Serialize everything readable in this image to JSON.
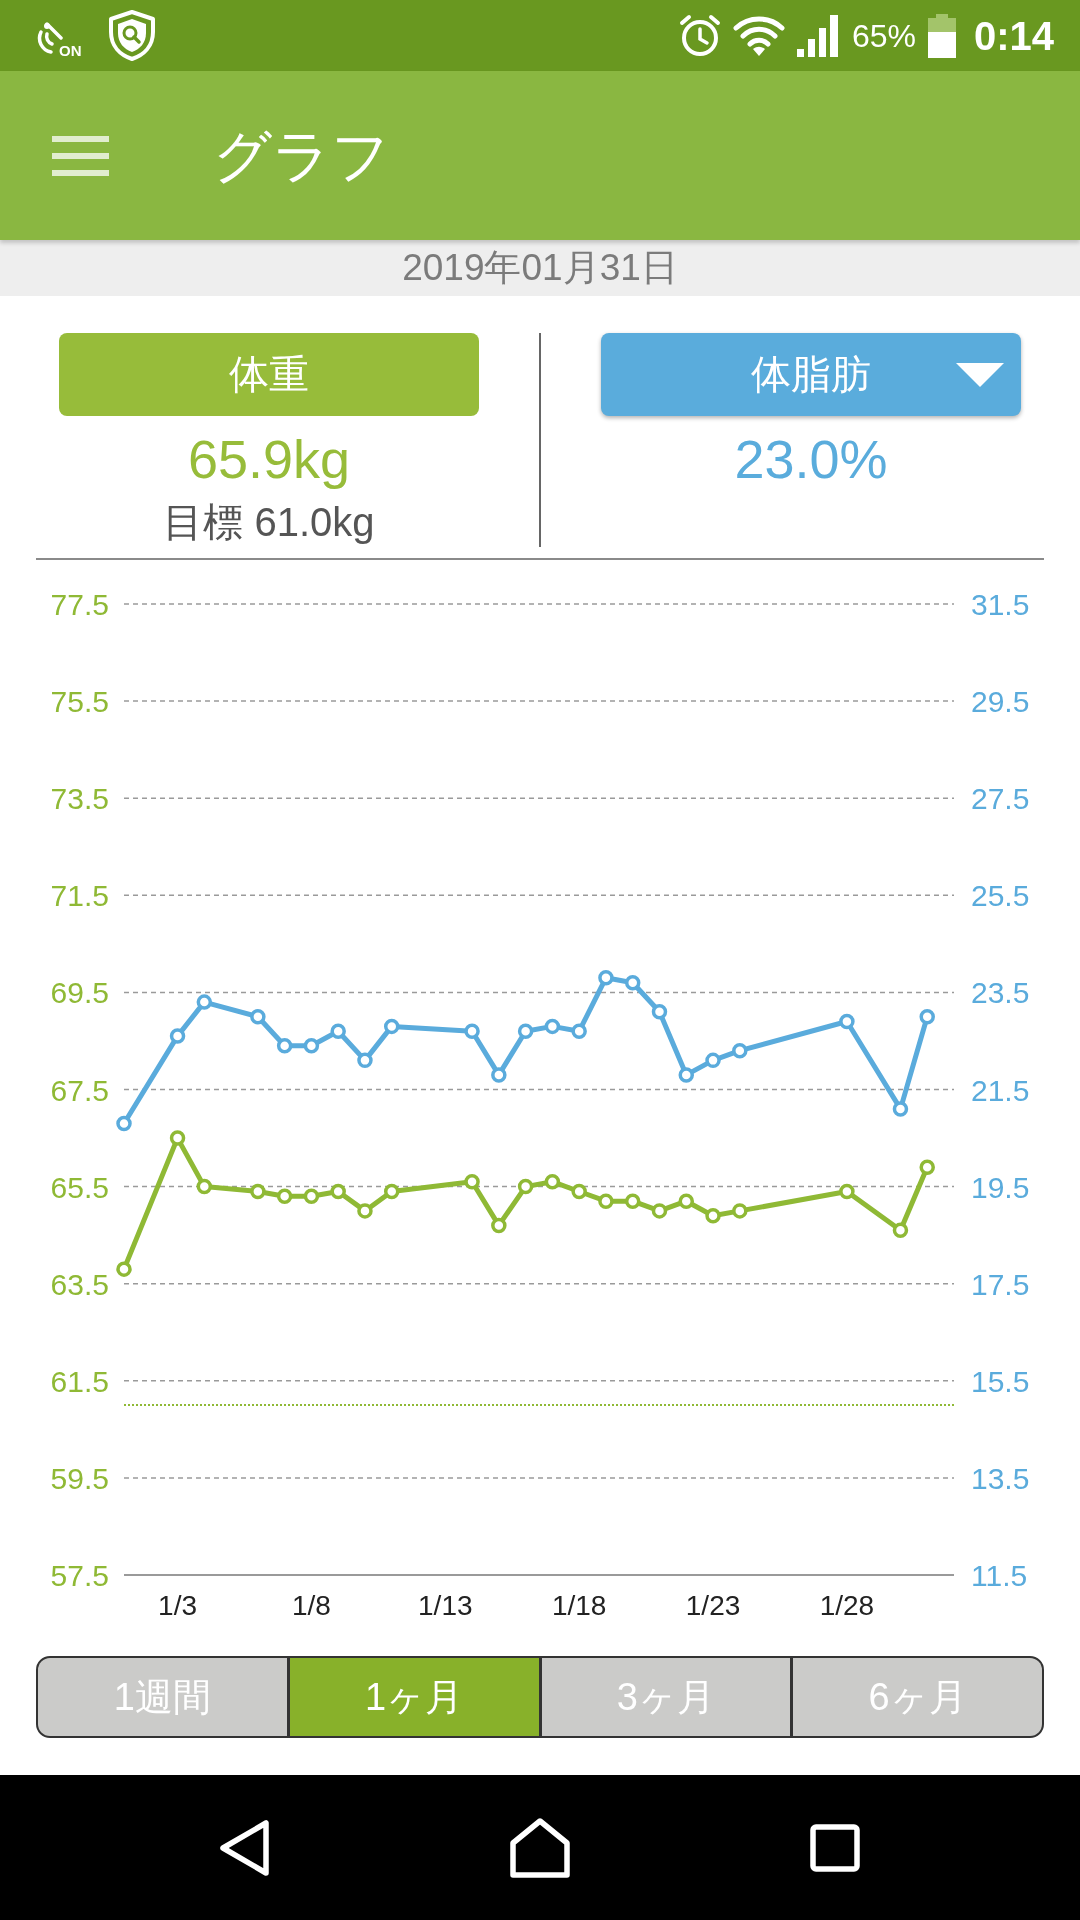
{
  "status_bar": {
    "nfc_label": "ON",
    "battery": "65%",
    "time": "0:14"
  },
  "app_bar": {
    "title": "グラフ"
  },
  "date_bar": {
    "date": "2019年01月31日"
  },
  "cards": [
    {
      "label": "体重",
      "value": "65.9kg",
      "goal": "目標 61.0kg",
      "color": "#97bc3a",
      "dropdown": false
    },
    {
      "label": "体脂肪",
      "value": "23.0%",
      "color": "#5aacdc",
      "dropdown": true
    }
  ],
  "chart": {
    "chart_data": {
      "type": "line",
      "categories": [
        null,
        null,
        "1/3",
        null,
        null,
        null,
        null,
        "1/8",
        null,
        null,
        null,
        null,
        "1/13",
        null,
        null,
        null,
        null,
        "1/18",
        null,
        null,
        null,
        null,
        "1/23",
        null,
        null,
        null,
        null,
        "1/28",
        null,
        null,
        null
      ],
      "series": [
        {
          "color": "#8fb935",
          "marker": "circle",
          "values": [
            63.8,
            null,
            66.5,
            65.5,
            null,
            65.4,
            65.3,
            65.3,
            65.4,
            65.0,
            65.4,
            null,
            null,
            65.6,
            64.7,
            65.5,
            65.6,
            65.4,
            65.2,
            65.2,
            65.0,
            65.2,
            64.9,
            65.0,
            null,
            null,
            null,
            65.4,
            null,
            64.6,
            65.9
          ]
        },
        {
          "axis": "y2",
          "color": "#5aabdc",
          "marker": "circle",
          "values": [
            20.8,
            null,
            22.6,
            23.3,
            null,
            23.0,
            22.4,
            22.4,
            22.7,
            22.1,
            22.8,
            null,
            null,
            22.7,
            21.8,
            22.7,
            22.8,
            22.7,
            23.8,
            23.7,
            23.1,
            21.8,
            22.1,
            22.3,
            null,
            null,
            null,
            22.9,
            null,
            21.1,
            23.0
          ]
        }
      ],
      "ylim": [
        57.5,
        77.5
      ],
      "y2lim": [
        11.5,
        31.5
      ],
      "yticks": [
        57.5,
        59.5,
        61.5,
        63.5,
        65.5,
        67.5,
        69.5,
        71.5,
        73.5,
        75.5,
        77.5
      ],
      "y2ticks": [
        11.5,
        13.5,
        15.5,
        17.5,
        19.5,
        21.5,
        23.5,
        25.5,
        27.5,
        29.5,
        31.5
      ],
      "grid": true,
      "ref_lines": [
        {
          "axis": "y",
          "value": 61.0,
          "color": "#8fb935"
        }
      ]
    }
  },
  "period_tabs": [
    {
      "label": "1週間",
      "selected": false
    },
    {
      "label": "1ヶ月",
      "selected": true
    },
    {
      "label": "3ヶ月",
      "selected": false
    },
    {
      "label": "6ヶ月",
      "selected": false
    }
  ]
}
